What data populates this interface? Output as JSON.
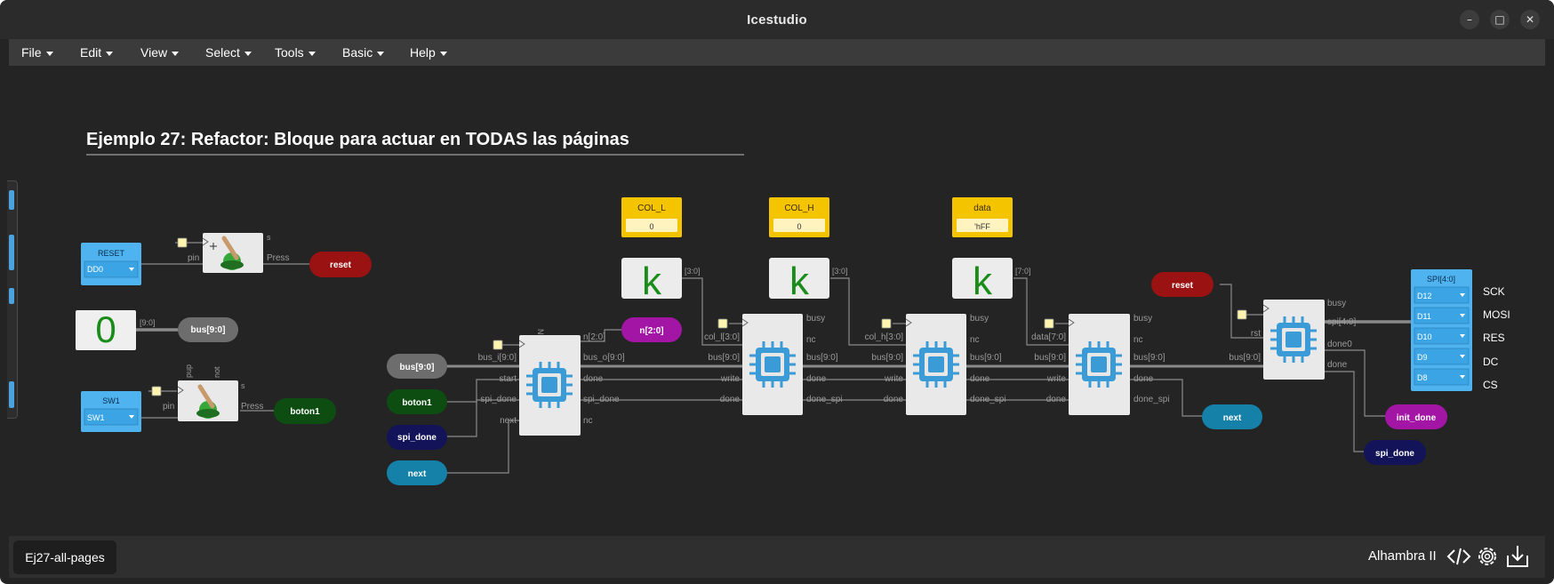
{
  "window": {
    "title": "Icestudio",
    "controls": {
      "minimize": "–",
      "maximize": "□",
      "close": "✕"
    }
  },
  "menu": {
    "items": [
      {
        "label": "File"
      },
      {
        "label": "Edit"
      },
      {
        "label": "View"
      },
      {
        "label": "Select"
      },
      {
        "label": "Tools"
      },
      {
        "label": "Basic"
      },
      {
        "label": "Help"
      }
    ]
  },
  "canvas": {
    "heading": "Ejemplo 27: Refactor: Bloque para actuar en TODAS las páginas",
    "reset_input": {
      "title": "RESET",
      "pin": "DD0"
    },
    "sw1_input": {
      "title": "SW1",
      "pin": "SW1"
    },
    "const_zero": {
      "value": "0",
      "port": "[9:0]"
    },
    "button_reset": {
      "pin": "pin",
      "out": "Press",
      "s": "s"
    },
    "button_sw1": {
      "pin": "pin",
      "out": "Press",
      "s": "s",
      "pup": "pup",
      "not": "not"
    },
    "labels": {
      "reset": "reset",
      "bus": "bus[9:0]",
      "boton1": "boton1",
      "n": "n[2:0]",
      "bus_in": "bus[9:0]",
      "boton1_in": "boton1",
      "spi_done_in": "spi_done",
      "next_in": "next",
      "next_out": "next",
      "reset_right": "reset",
      "init_done": "init_done",
      "spi_done_out": "spi_done"
    },
    "params": [
      {
        "name": "COL_L",
        "value": "0",
        "port": "[3:0]"
      },
      {
        "name": "COL_H",
        "value": "0",
        "port": "[3:0]"
      },
      {
        "name": "data",
        "value": "'hFF",
        "port": "[7:0]"
      }
    ],
    "block1": {
      "top": "N",
      "in": [
        "bus_i[9:0]",
        "start",
        "spi_done",
        "next"
      ],
      "out": [
        "n[2:0]",
        "bus_o[9:0]",
        "done",
        "spi_done",
        "nc"
      ]
    },
    "writer_blocks": [
      {
        "param_in": "col_l[3:0]",
        "in": [
          "bus[9:0]",
          "write",
          "done"
        ],
        "out": [
          "busy",
          "nc",
          "bus[9:0]",
          "done",
          "done_spi"
        ]
      },
      {
        "param_in": "col_h[3:0]",
        "in": [
          "bus[9:0]",
          "write",
          "done"
        ],
        "out": [
          "busy",
          "nc",
          "bus[9:0]",
          "done",
          "done_spi"
        ]
      },
      {
        "param_in": "data[7:0]",
        "in": [
          "bus[9:0]",
          "write",
          "done"
        ],
        "out": [
          "busy",
          "nc",
          "bus[9:0]",
          "done",
          "done_spi"
        ]
      }
    ],
    "spi_block": {
      "in": [
        "rst",
        "bus[9:0]"
      ],
      "out": [
        "busy",
        "spi[4:0]",
        "done0",
        "done"
      ]
    },
    "spi_output": {
      "title": "SPI[4:0]",
      "pins": [
        "D12",
        "D11",
        "D10",
        "D9",
        "D8"
      ],
      "names": [
        "SCK",
        "MOSI",
        "RES",
        "DC",
        "CS"
      ]
    }
  },
  "status": {
    "tab": "Ej27-all-pages",
    "board": "Alhambra II",
    "icons": [
      "code-icon",
      "gear-icon",
      "download-icon"
    ]
  },
  "colors": {
    "reset_red": "#9a1212",
    "grey_label": "#6d6d6d",
    "green_label": "#0e4d12",
    "navy_label": "#13135a",
    "teal_label": "#1581a8",
    "magenta_label": "#a315a5",
    "io_blue": "#4fb3f0",
    "param_yellow": "#f5c400",
    "chip_blue": "#3a9bd6",
    "wire": "#8a8a8a"
  }
}
